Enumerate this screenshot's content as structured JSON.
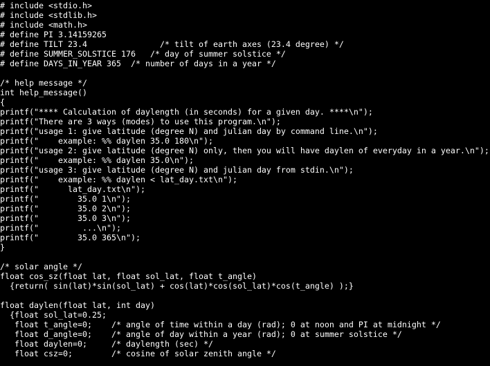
{
  "terminal": {
    "colors": {
      "background": "#000000",
      "foreground": "#ffffff"
    },
    "lines": [
      "# include <stdio.h>",
      "# include <stdlib.h>",
      "# include <math.h>",
      "# define PI 3.14159265",
      "# define TILT 23.4               /* tilt of earth axes (23.4 degree) */",
      "# define SUMMER_SOLSTICE 176   /* day of summer solstice */",
      "# define DAYS_IN_YEAR 365  /* number of days in a year */",
      "",
      "/* help message */",
      "int help_message()",
      "{",
      "printf(\"**** Calculation of daylength (in seconds) for a given day. ****\\n\");",
      "printf(\"There are 3 ways (modes) to use this program.\\n\");",
      "printf(\"usage 1: give latitude (degree N) and julian day by command line.\\n\");",
      "printf(\"    example: %% daylen 35.0 180\\n\");",
      "printf(\"usage 2: give latitude (degree N) only, then you will have daylen of everyday in a year.\\n\");",
      "printf(\"    example: %% daylen 35.0\\n\");",
      "printf(\"usage 3: give latitude (degree N) and julian day from stdin.\\n\");",
      "printf(\"    example: %% daylen < lat_day.txt\\n\");",
      "printf(\"      lat_day.txt\\n\");",
      "printf(\"        35.0 1\\n\");",
      "printf(\"        35.0 2\\n\");",
      "printf(\"        35.0 3\\n\");",
      "printf(\"         ...\\n\");",
      "printf(\"        35.0 365\\n\");",
      "}",
      "",
      "/* solar angle */",
      "float cos_sz(float lat, float sol_lat, float t_angle)",
      "  {return( sin(lat)*sin(sol_lat) + cos(lat)*cos(sol_lat)*cos(t_angle) );}",
      "",
      "float daylen(float lat, int day)",
      "  {float sol_lat=0.25;",
      "   float t_angle=0;    /* angle of time within a day (rad); 0 at noon and PI at midnight */",
      "   float d_angle=0;    /* angle of day within a year (rad); 0 at summer solstice */",
      "   float daylen=0;     /* daylength (sec) */",
      "   float csz=0;        /* cosine of solar zenith angle */"
    ]
  }
}
